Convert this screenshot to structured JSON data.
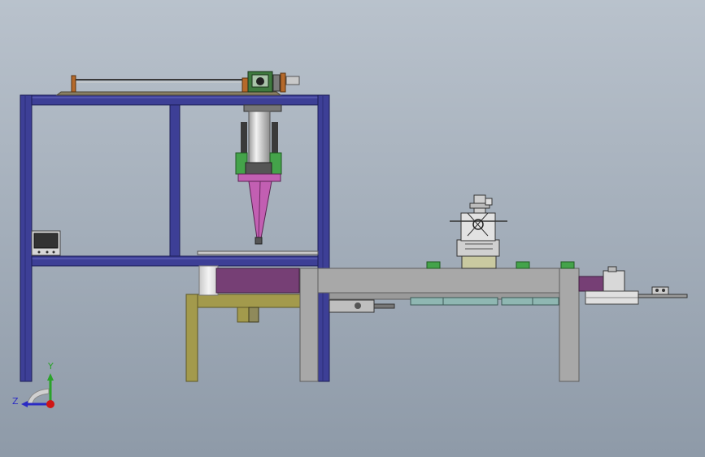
{
  "viewport": {
    "background_top": "#b9c2cc",
    "background_bottom": "#8e9aa8"
  },
  "colors": {
    "frame_blue": "#3d3f96",
    "frame_blue_dark": "#25276a",
    "table_gray": "#a8a8a8",
    "table_gray_dark": "#5e5e5e",
    "olive": "#a39a4c",
    "olive_dark": "#5d5726",
    "purple": "#763f75",
    "pink": "#c25fb2",
    "green": "#44a34a",
    "teal": "#8fb7b2",
    "red": "#c41f1f",
    "cylinder": "#d8d8d8"
  },
  "triad": {
    "y_label": "Y",
    "z_label": "Z",
    "y_color": "#2aa22a",
    "z_color": "#2b2bc4",
    "x_color": "#d01515"
  },
  "model": {
    "name": "assembly-model",
    "icon": "3d-assembly-icon"
  }
}
